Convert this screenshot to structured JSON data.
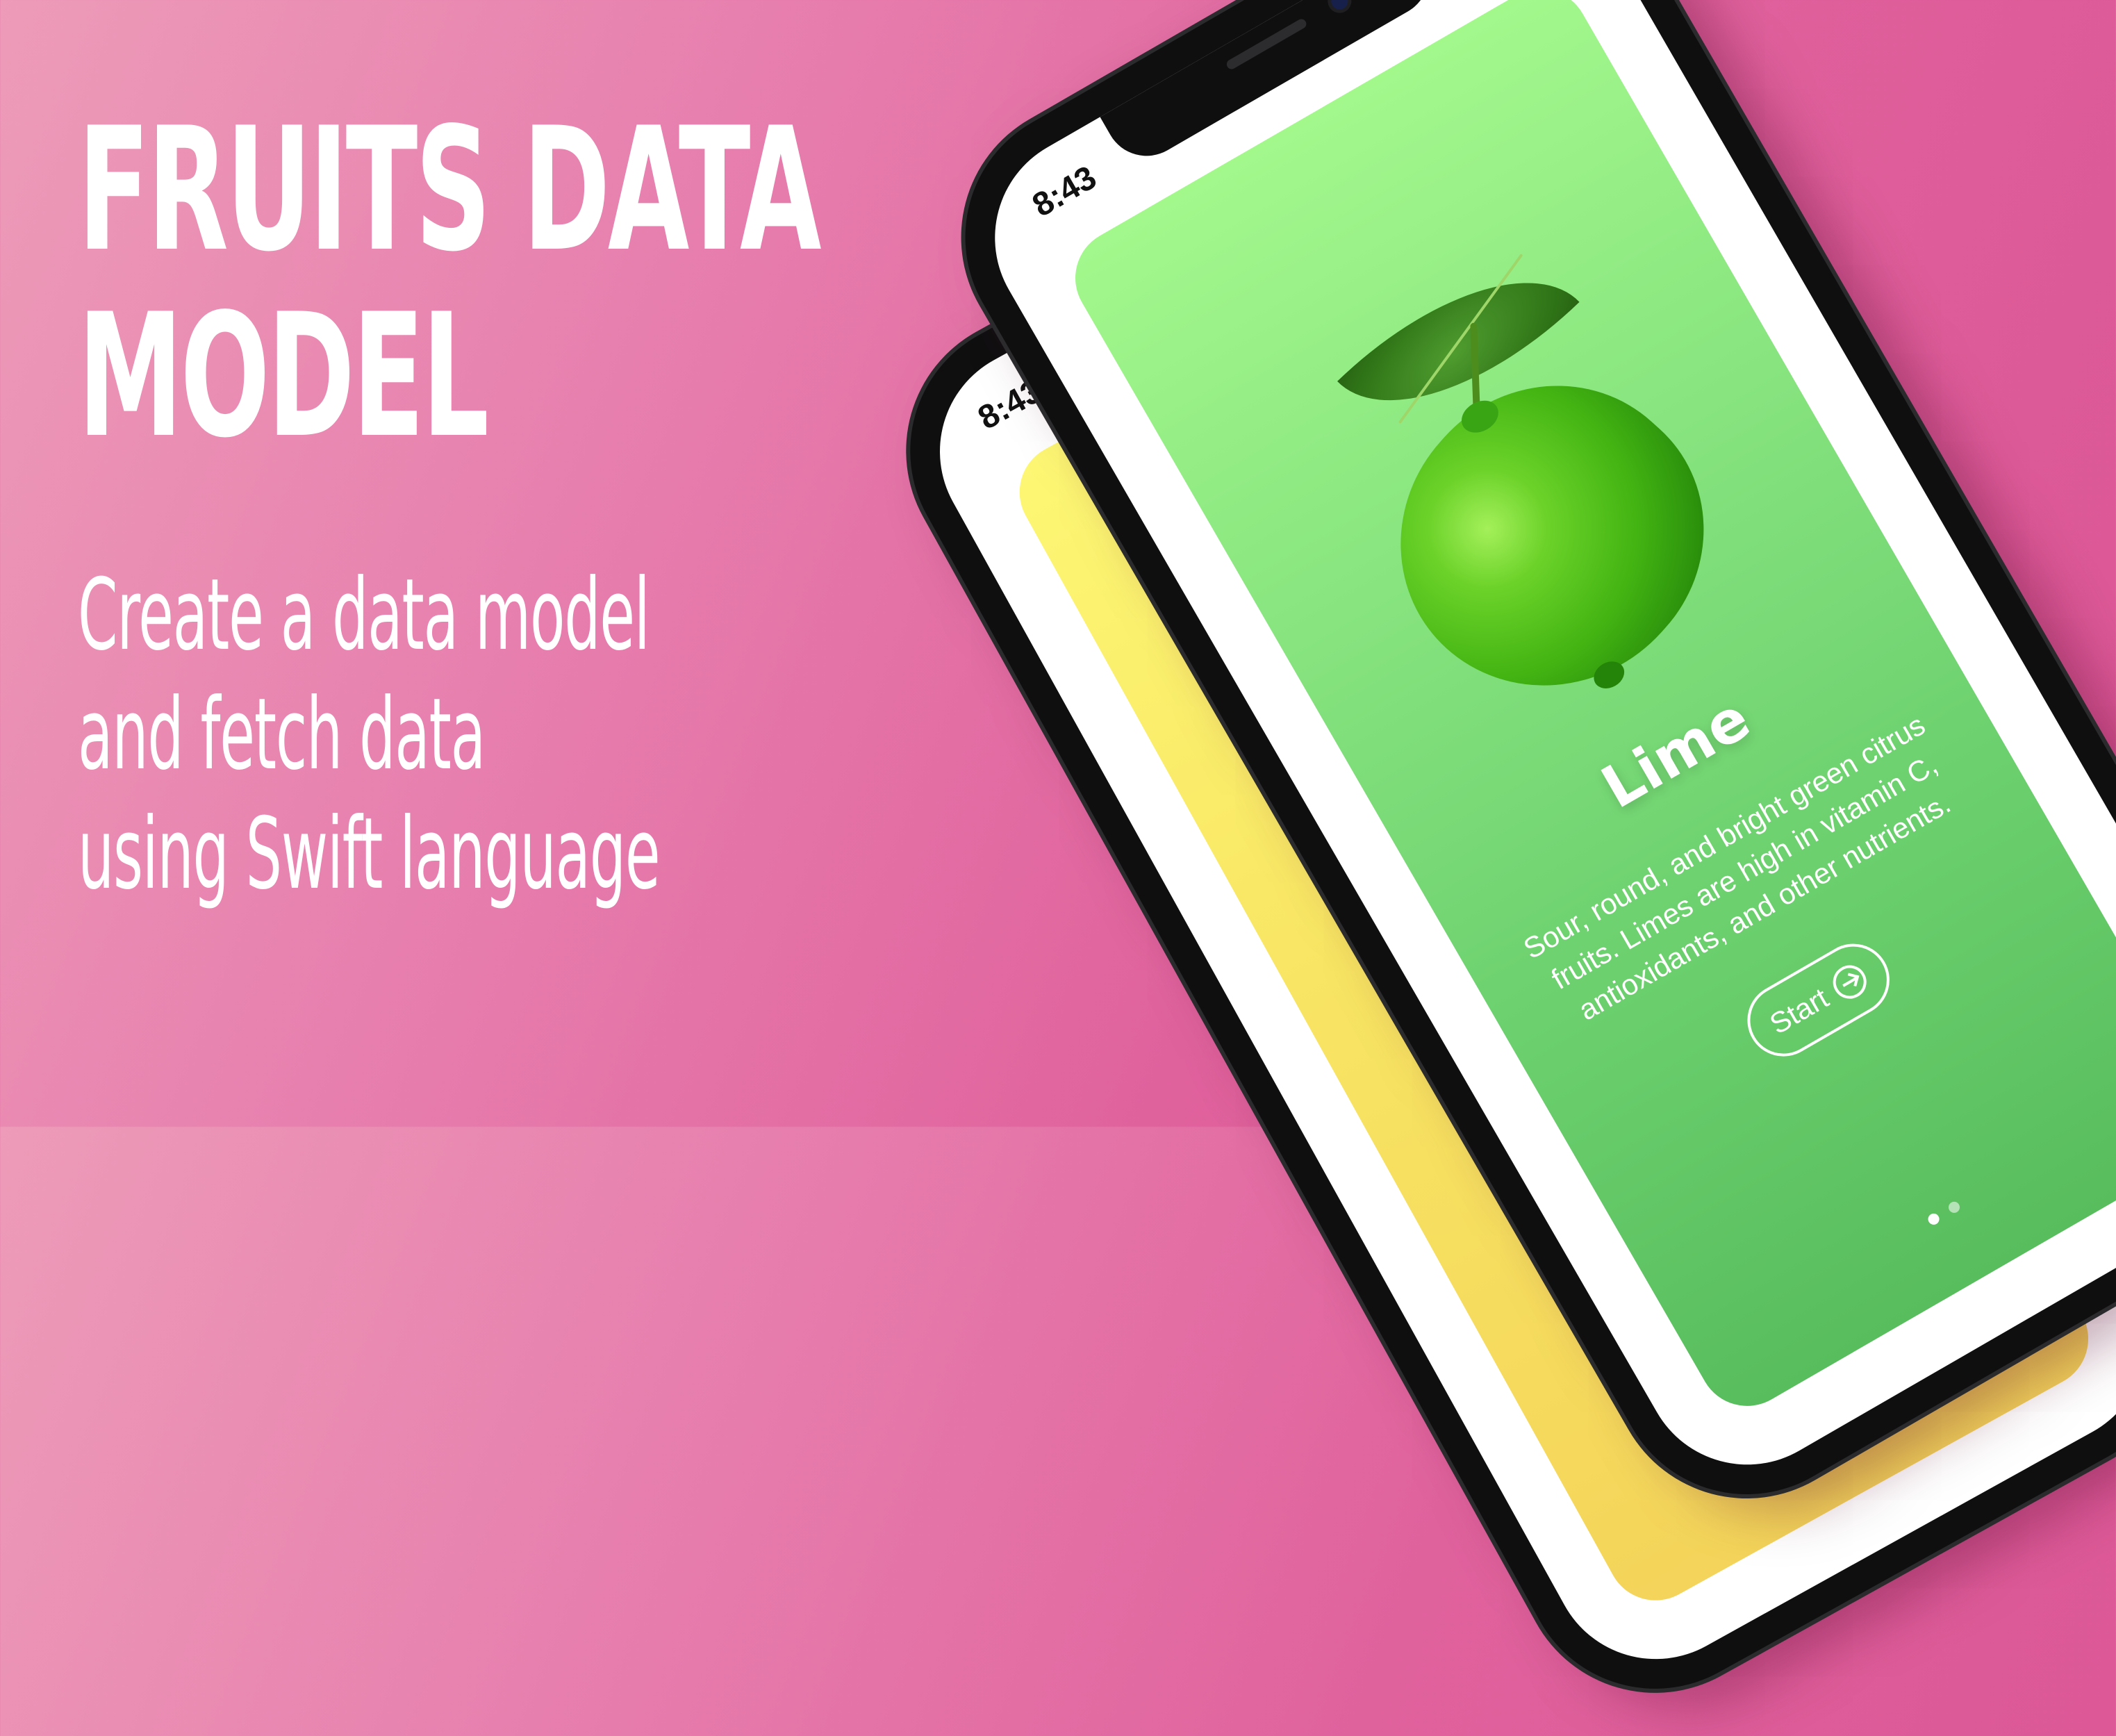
{
  "headline": {
    "line1": "FRUITS DATA",
    "line2": "MODEL"
  },
  "subtitle": {
    "line1": "Create a data model",
    "line2": "and fetch data",
    "line3": "using Swift language"
  },
  "phone_back": {
    "status_time": "8:43",
    "card_color": "#f8e563"
  },
  "phone_front": {
    "status_time": "8:43",
    "card": {
      "title": "Lime",
      "description": "Sour, round, and bright green citrus fruits. Limes are high in vitamin C, antioxidants, and other nutrients.",
      "start_label": "Start",
      "start_icon": "arrow-right-circle-icon",
      "colors": [
        "#a3f88c",
        "#58bd5d"
      ]
    },
    "page_indicator": {
      "current": 1,
      "total": 2
    }
  },
  "colors": {
    "background": "#e0629d",
    "text": "#ffffff"
  }
}
